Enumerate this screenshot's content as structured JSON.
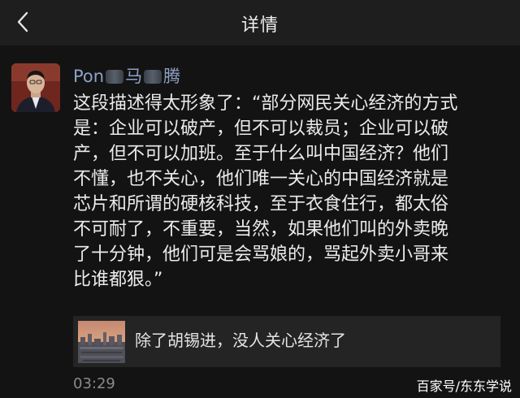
{
  "nav": {
    "title": "详情",
    "back_icon": "chevron-left-icon"
  },
  "post": {
    "author": {
      "prefix": "Pon",
      "middle": "马",
      "suffix": "腾"
    },
    "lines": [
      "这段描述得太形象了：“部分网民关心经济的方式",
      "是：企业可以破产，但不可以裁员；企业可以破",
      "产，但不可以加班。至于什么叫中国经济？他们",
      "不懂，也不关心，他们唯一关心的中国经济就是",
      "芯片和所谓的硬核科技，至于衣食住行，都太俗",
      "不可耐了，不重要，当然，如果他们叫的外卖晚",
      "了十分钟，他们可是会骂娘的，骂起外卖小哥来",
      "比谁都狠。”"
    ],
    "share": {
      "title": "除了胡锡进，没人关心经济了"
    },
    "time": "03:29"
  },
  "watermark": "百家号/东东学说",
  "colors": {
    "background": "#131313",
    "nav_background": "#1e1e1e",
    "author_name": "#8ea2c6",
    "text": "#ebebeb",
    "card": "#242424",
    "timestamp": "#8a8a8a"
  }
}
